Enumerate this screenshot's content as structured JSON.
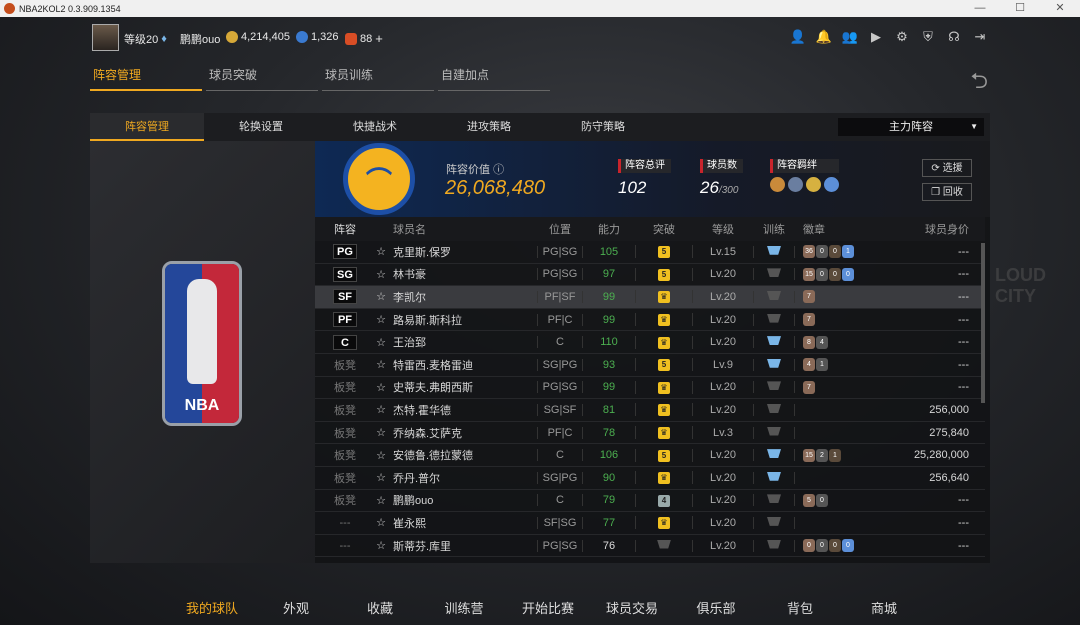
{
  "window": {
    "title": "NBA2KOL2 0.3.909.1354"
  },
  "user": {
    "level": "等级20",
    "name": "鹏鹏ouo",
    "coins": "4,214,405",
    "stars": "1,326",
    "points": "88"
  },
  "main_tabs": [
    "阵容管理",
    "球员突破",
    "球员训练",
    "自建加点"
  ],
  "sub_tabs": [
    "阵容管理",
    "轮换设置",
    "快捷战术",
    "进攻策略",
    "防守策略"
  ],
  "lineup_select": "主力阵容",
  "team": {
    "logo": "GSW",
    "value_label": "阵容价值",
    "value": "26,068,480"
  },
  "stats": {
    "overall_label": "阵容总评",
    "overall": "102",
    "players_label": "球员数",
    "players": "26",
    "players_max": "/300",
    "bonds_label": "阵容羁绊"
  },
  "buttons": {
    "select": "选援",
    "recycle": "回收"
  },
  "table_headers": [
    "阵容",
    "球员名",
    "位置",
    "能力",
    "突破",
    "等级",
    "训练",
    "徽章",
    "球员身价"
  ],
  "rows": [
    {
      "slot": "PG",
      "name": "克里斯.保罗",
      "pos": "PG|SG",
      "abil": "105",
      "brk": "5",
      "lvl": "Lv.15",
      "train": "blue",
      "badges": [
        "36",
        "0",
        "0",
        "1"
      ],
      "worth": "---"
    },
    {
      "slot": "SG",
      "name": "林书豪",
      "pos": "PG|SG",
      "abil": "97",
      "brk": "5",
      "lvl": "Lv.20",
      "train": "grey",
      "badges": [
        "15",
        "0",
        "0",
        "0"
      ],
      "worth": "---"
    },
    {
      "slot": "SF",
      "name": "李凯尔",
      "pos": "PF|SF",
      "abil": "99",
      "brk": "♛",
      "lvl": "Lv.20",
      "train": "grey",
      "badges": [
        "7"
      ],
      "worth": "---"
    },
    {
      "slot": "PF",
      "name": "路易斯.斯科拉",
      "pos": "PF|C",
      "abil": "99",
      "brk": "♛",
      "lvl": "Lv.20",
      "train": "grey",
      "badges": [
        "7"
      ],
      "worth": "---"
    },
    {
      "slot": "C",
      "name": "王治郅",
      "pos": "C",
      "abil": "110",
      "brk": "♛",
      "lvl": "Lv.20",
      "train": "blue",
      "badges": [
        "8",
        "4"
      ],
      "worth": "---"
    },
    {
      "slot": "板凳",
      "name": "特雷西.麦格雷迪",
      "pos": "SG|PG",
      "abil": "93",
      "brk": "5",
      "lvl": "Lv.9",
      "train": "blue",
      "badges": [
        "4",
        "1"
      ],
      "worth": "---"
    },
    {
      "slot": "板凳",
      "name": "史蒂夫.弗朗西斯",
      "pos": "PG|SG",
      "abil": "99",
      "brk": "♛",
      "lvl": "Lv.20",
      "train": "grey",
      "badges": [
        "7"
      ],
      "worth": "---"
    },
    {
      "slot": "板凳",
      "name": "杰特.霍华德",
      "pos": "SG|SF",
      "abil": "81",
      "brk": "♛",
      "lvl": "Lv.20",
      "train": "grey",
      "badges": [],
      "worth": "256,000"
    },
    {
      "slot": "板凳",
      "name": "乔纳森.艾萨克",
      "pos": "PF|C",
      "abil": "78",
      "brk": "♛",
      "lvl": "Lv.3",
      "train": "grey",
      "badges": [],
      "worth": "275,840"
    },
    {
      "slot": "板凳",
      "name": "安德鲁.德拉蒙德",
      "pos": "C",
      "abil": "106",
      "brk": "5",
      "lvl": "Lv.20",
      "train": "blue",
      "badges": [
        "15",
        "2",
        "1"
      ],
      "worth": "25,280,000"
    },
    {
      "slot": "板凳",
      "name": "乔丹.普尔",
      "pos": "SG|PG",
      "abil": "90",
      "brk": "♛",
      "lvl": "Lv.20",
      "train": "blue",
      "badges": [],
      "worth": "256,640"
    },
    {
      "slot": "板凳",
      "name": "鹏鹏ouo",
      "pos": "C",
      "abil": "79",
      "brk": "4",
      "lvl": "Lv.20",
      "train": "grey",
      "badges": [
        "5",
        "0"
      ],
      "worth": "---"
    },
    {
      "slot": "---",
      "name": "崔永熙",
      "pos": "SF|SG",
      "abil": "77",
      "brk": "♛",
      "lvl": "Lv.20",
      "train": "grey",
      "badges": [],
      "worth": "---"
    },
    {
      "slot": "---",
      "name": "斯蒂芬.库里",
      "pos": "PG|SG",
      "abil": "76",
      "brk": "",
      "lvl": "Lv.20",
      "train": "grey",
      "badges": [
        "0",
        "0",
        "0",
        "0"
      ],
      "worth": "---"
    }
  ],
  "bottom_nav": [
    "我的球队",
    "外观",
    "收藏",
    "训练营",
    "开始比赛",
    "球员交易",
    "俱乐部",
    "背包",
    "商城"
  ],
  "colors": {
    "accent": "#f0a920",
    "ability": "#4caf50"
  }
}
